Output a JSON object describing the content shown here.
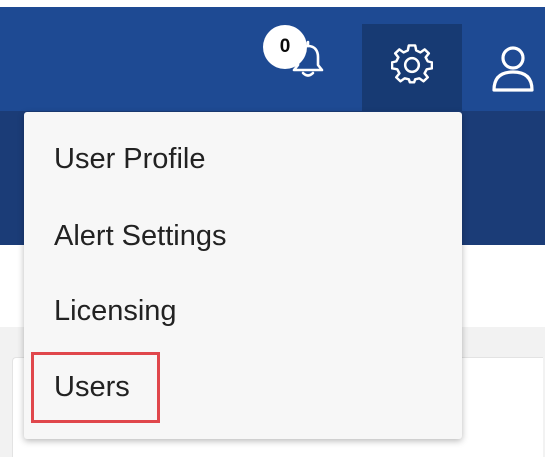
{
  "header": {
    "notification_count": "0",
    "icons": {
      "bell": "bell-icon",
      "settings": "gear-icon",
      "user": "user-icon"
    },
    "colors": {
      "header_blue": "#1e4a93",
      "active_button": "#173a73",
      "sub_band": "#1b3c77"
    }
  },
  "settings_menu": {
    "items": [
      {
        "label": "User Profile"
      },
      {
        "label": "Alert Settings"
      },
      {
        "label": "Licensing"
      },
      {
        "label": "Users",
        "highlighted": true
      }
    ],
    "highlight_color": "#e0474c"
  }
}
